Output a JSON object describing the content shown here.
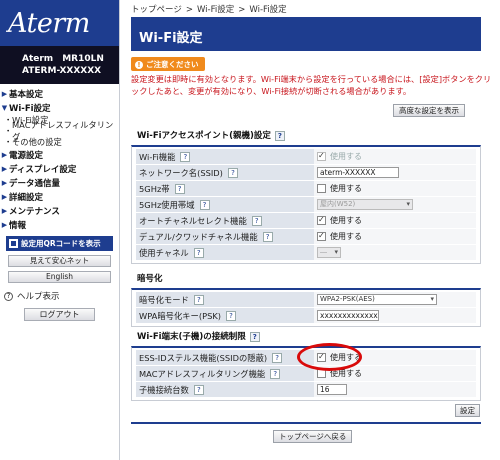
{
  "brand": {
    "logo": "Aterm",
    "model": "Aterm　MR10LN",
    "device_id": "ATERM-XXXXXX"
  },
  "menu": {
    "basic": "基本設定",
    "wifi": "Wi-Fi設定",
    "wifi_sub": [
      "Wi-Fi設定",
      "MACアドレスフィルタリング",
      "その他の設定"
    ],
    "power": "電源設定",
    "display": "ディスプレイ設定",
    "data": "データ通信量",
    "detail": "詳細設定",
    "maint": "メンテナンス",
    "info": "情報"
  },
  "sidebar": {
    "qr_label": "設定用QRコードを表示",
    "easy_net": "見えて安心ネット",
    "english": "English",
    "help": "ヘルプ表示",
    "logout": "ログアウト"
  },
  "breadcrumb": [
    "トップページ",
    "Wi-Fi設定",
    "Wi-Fi設定"
  ],
  "page_title": "Wi-Fi設定",
  "notice": {
    "label": "ご注意ください",
    "text": "設定変更は即時に有効となります。Wi-Fi端末から設定を行っている場合には、[設定]ボタンをクリックしたあと、変更が有効になり、Wi-Fi接続が切断される場合があります。"
  },
  "advanced_button": "高度な設定を表示",
  "sections": {
    "ap": {
      "title": "Wi-Fiアクセスポイント(親機)設定",
      "wifi_func": {
        "label": "Wi-Fi機能",
        "value": "使用する"
      },
      "ssid": {
        "label": "ネットワーク名(SSID)",
        "value": "aterm-XXXXXX"
      },
      "ghz5": {
        "label": "5GHz帯",
        "value": "使用する"
      },
      "band5": {
        "label": "5GHz使用帯域",
        "value": "屋内(W52)"
      },
      "auto_channel": {
        "label": "オートチャネルセレクト機能",
        "value": "使用する"
      },
      "dual_quad": {
        "label": "デュアル/クワッドチャネル機能",
        "value": "使用する"
      },
      "channel": {
        "label": "使用チャネル",
        "value": "―"
      }
    },
    "enc": {
      "title": "暗号化",
      "mode": {
        "label": "暗号化モード",
        "value": "WPA2-PSK(AES)"
      },
      "key": {
        "label": "WPA暗号化キー(PSK)",
        "value": "xxxxxxxxxxxxx"
      }
    },
    "limit": {
      "title": "Wi-Fi端末(子機)の接続制限",
      "stealth": {
        "label": "ESS-IDステルス機能(SSIDの隠蔽)",
        "value": "使用する"
      },
      "mac": {
        "label": "MACアドレスフィルタリング機能",
        "value": "使用する"
      },
      "count": {
        "label": "子機接続台数",
        "value": "16"
      }
    }
  },
  "settings_button": "設定",
  "back_top_button": "トップページへ戻る",
  "help_glyph": "?",
  "colors": {
    "brand_blue": "#1e3d8f",
    "notice_orange": "#f08a1c",
    "warning_red": "#c8161d",
    "highlight_red": "#d90a0a"
  }
}
